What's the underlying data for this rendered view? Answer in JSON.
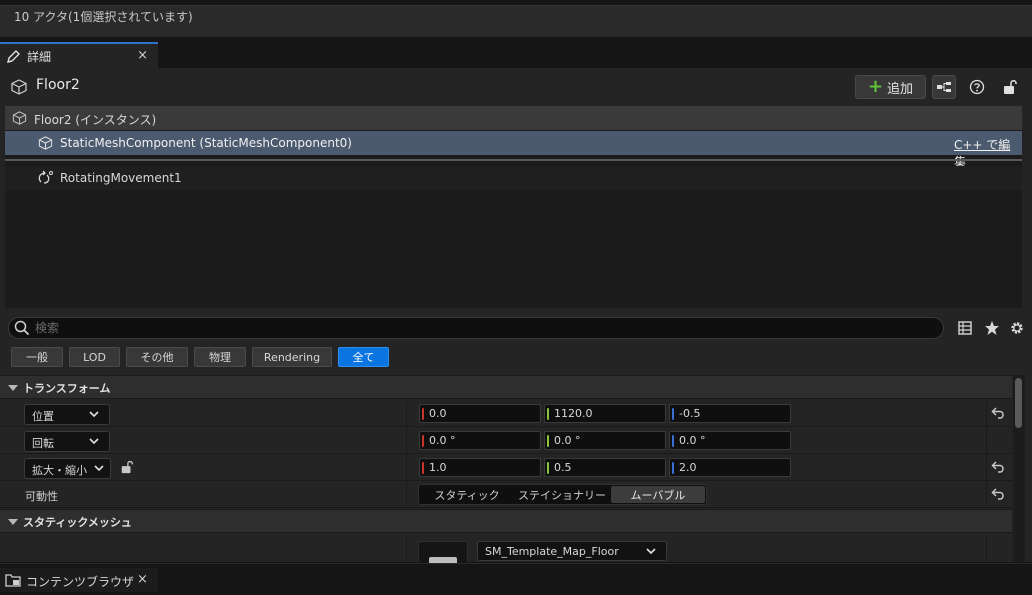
{
  "status": {
    "selection_text": "10 アクタ(1個選択されています)"
  },
  "tabs": {
    "details_label": "詳細",
    "close_glyph": "×"
  },
  "header": {
    "object_name": "Floor2",
    "add_label": "追加",
    "icons": [
      "cube-icon",
      "plus-icon",
      "blueprint-icon",
      "help-icon",
      "lock-icon"
    ]
  },
  "tree": {
    "root_label": "Floor2 (インスタンス)",
    "selected_label": "StaticMeshComponent (StaticMeshComponent0)",
    "edit_cpp_label": "C++ で編集",
    "child_label": "RotatingMovement1"
  },
  "search": {
    "placeholder": "検索"
  },
  "filters": [
    "一般",
    "LOD",
    "その他",
    "物理",
    "Rendering",
    "全て"
  ],
  "filter_active": "全て",
  "transform": {
    "category": "トランスフォーム",
    "location": {
      "label": "位置",
      "x": "0.0",
      "y": "1120.0",
      "z": "-0.5"
    },
    "rotation": {
      "label": "回転",
      "x": "0.0 °",
      "y": "0.0 °",
      "z": "0.0 °"
    },
    "scale": {
      "label": "拡大・縮小",
      "x": "1.0",
      "y": "0.5",
      "z": "2.0"
    },
    "mobility": {
      "label": "可動性",
      "options": [
        "スタティック",
        "ステイショナリー",
        "ムーバブル"
      ],
      "selected": "ムーバブル"
    }
  },
  "static_mesh": {
    "category": "スタティックメッシュ",
    "mesh_name": "SM_Template_Map_Floor"
  },
  "bottom": {
    "content_browser_label": "コンテンツブラウザ"
  },
  "colors": {
    "accent": "#0a74e0",
    "axis_x": "#c8362a",
    "axis_y": "#8ac43a",
    "axis_z": "#3a6fd8",
    "add_plus": "#5fc43a"
  }
}
